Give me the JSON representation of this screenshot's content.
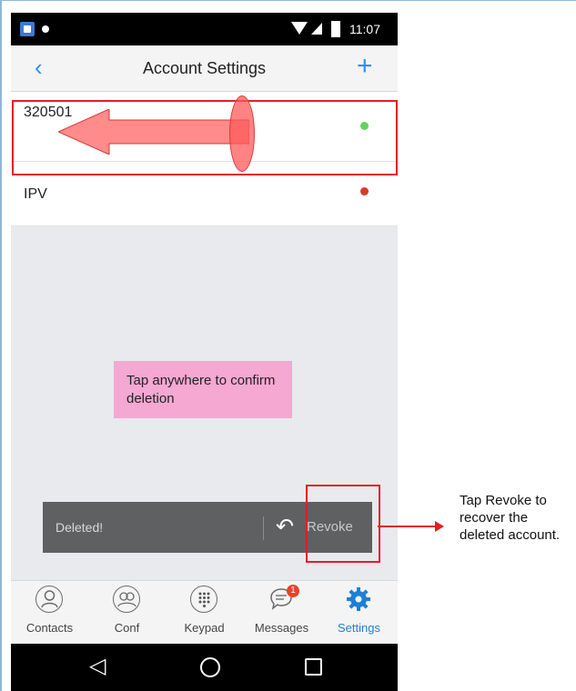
{
  "status_bar": {
    "time": "11:07"
  },
  "header": {
    "title": "Account Settings",
    "back_icon": "chevron-left-icon",
    "add_icon": "plus-icon",
    "accent_color": "#2f8ff0"
  },
  "accounts": [
    {
      "name": "320501",
      "status_color": "#5fd35f"
    },
    {
      "name": "IPV",
      "status_color": "#d63a2a"
    }
  ],
  "tip_text": "Tap anywhere to confirm deletion",
  "snackbar": {
    "message": "Deleted!",
    "action_label": "Revoke",
    "action_icon": "undo-icon"
  },
  "bottom_nav": {
    "items": [
      {
        "label": "Contacts",
        "icon": "contact-icon"
      },
      {
        "label": "Conf",
        "icon": "conference-icon"
      },
      {
        "label": "Keypad",
        "icon": "keypad-icon"
      },
      {
        "label": "Messages",
        "icon": "message-icon",
        "badge": "1"
      },
      {
        "label": "Settings",
        "icon": "gear-icon",
        "active": true
      }
    ]
  },
  "callout": {
    "text": "Tap Revoke to recover the deleted account."
  },
  "annotation_color": "#e31e24"
}
